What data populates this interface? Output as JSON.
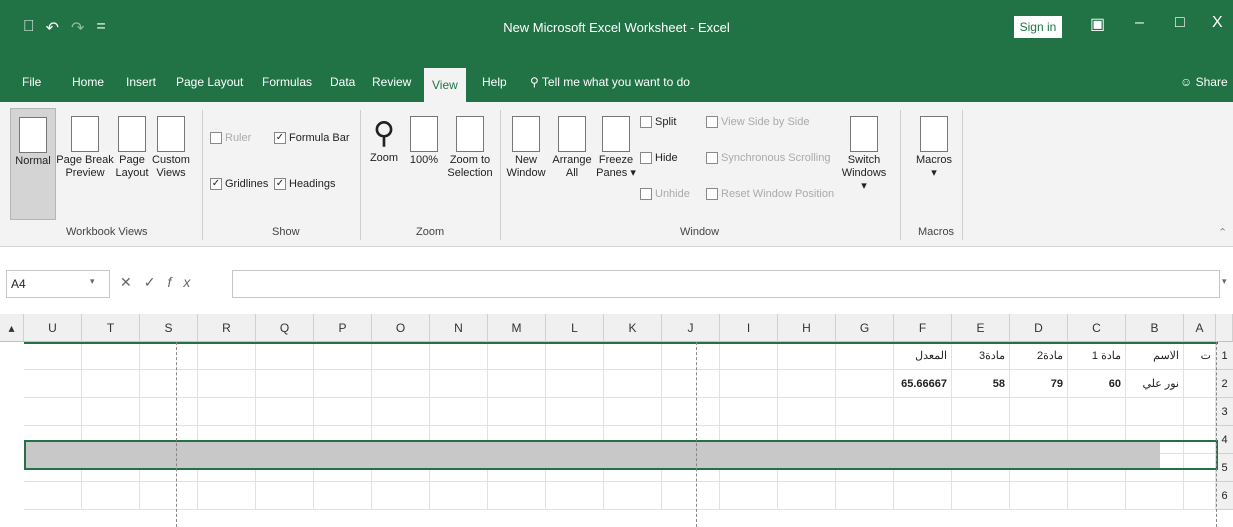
{
  "window": {
    "title": "New Microsoft Excel Worksheet  -  Excel",
    "signin": "Sign in",
    "qat": [
      "⎕",
      "↶",
      "↷",
      "="
    ],
    "controls": [
      "▣",
      "–",
      "ᴮ",
      "X"
    ]
  },
  "tabs": [
    "File",
    "Home",
    "Insert",
    "Page Layout",
    "Formulas",
    "Data",
    "Review",
    "View",
    "Help"
  ],
  "active_tab": "View",
  "tellme": "Tell me what you want to do",
  "share": "Share",
  "ribbon": {
    "workbook_views": {
      "label": "Workbook Views",
      "buttons": [
        "Normal",
        "Page Break\nPreview",
        "Page\nLayout",
        "Custom\nViews"
      ]
    },
    "show": {
      "label": "Show",
      "ruler": "Ruler",
      "formula_bar": "Formula Bar",
      "gridlines": "Gridlines",
      "headings": "Headings"
    },
    "zoom": {
      "label": "Zoom",
      "buttons": [
        "Zoom",
        "100%",
        "Zoom to\nSelection"
      ]
    },
    "window": {
      "label": "Window",
      "buttons": [
        "New\nWindow",
        "Arrange\nAll",
        "Freeze\nPanes ▾"
      ],
      "split": "Split",
      "hide": "Hide",
      "unhide": "Unhide",
      "side_by_side": "View Side by Side",
      "sync_scroll": "Synchronous Scrolling",
      "reset_pos": "Reset Window Position",
      "switch": "Switch\nWindows ▾"
    },
    "macros": {
      "label": "Macros",
      "button": "Macros"
    }
  },
  "formula": {
    "namebox": "A4",
    "fx": "fx",
    "value": ""
  },
  "grid": {
    "columns": [
      "U",
      "T",
      "S",
      "R",
      "Q",
      "P",
      "O",
      "N",
      "M",
      "L",
      "K",
      "J",
      "I",
      "H",
      "G",
      "F",
      "E",
      "D",
      "C",
      "B",
      "A"
    ],
    "rows": [
      "1",
      "2",
      "3",
      "4",
      "5",
      "6"
    ],
    "r1": {
      "F": "المعدل",
      "E": "مادة3",
      "D": "مادة2",
      "C": "مادة 1",
      "B": "الاسم",
      "A": "ت"
    },
    "r2": {
      "F": "65.66667",
      "E": "58",
      "D": "79",
      "C": "60",
      "B": "نور علي"
    }
  }
}
